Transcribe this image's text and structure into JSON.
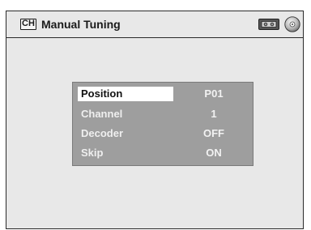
{
  "header": {
    "ch_icon_text": "CH",
    "title": "Manual Tuning",
    "icons": [
      "vcr-tape-icon",
      "dvd-disc-icon"
    ]
  },
  "menu": {
    "selected_index": 0,
    "items": [
      {
        "label": "Position",
        "value": "P01"
      },
      {
        "label": "Channel",
        "value": "1"
      },
      {
        "label": "Decoder",
        "value": "OFF"
      },
      {
        "label": "Skip",
        "value": "ON"
      }
    ]
  },
  "colors": {
    "background": "#e8e8e8",
    "menu_panel": "#9e9e9e",
    "highlight": "#ffffff",
    "text_light": "#efefef",
    "text_dark": "#111111"
  }
}
